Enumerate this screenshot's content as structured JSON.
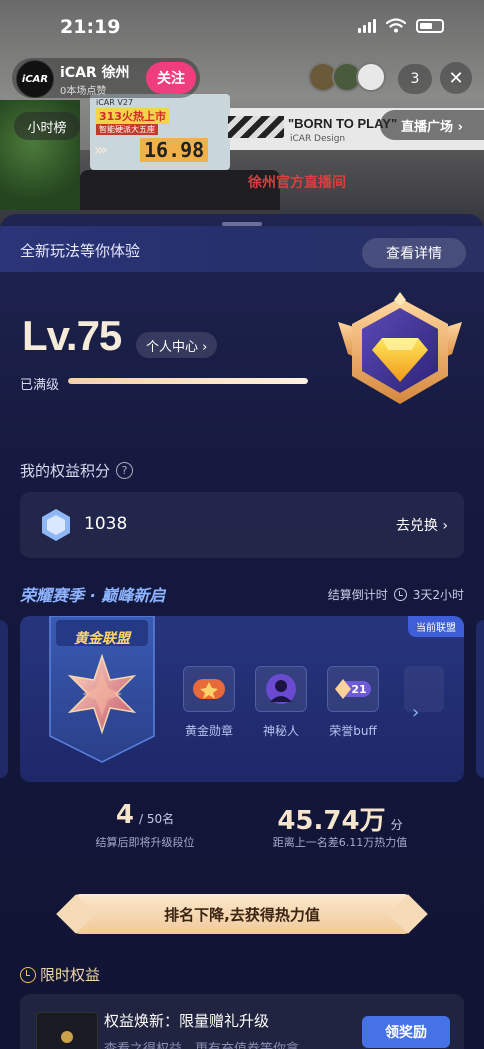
{
  "status_bar": {
    "time": "21:19"
  },
  "stream": {
    "host_avatar_text": "iCAR",
    "host_name": "iCAR 徐州",
    "host_likes": "0本场点赞",
    "follow_label": "关注",
    "viewer_count": "3",
    "hourly_rank_label": "小时榜",
    "live_square_label": "直播广场 ›",
    "scene": {
      "promo_brand": "iCAR V27",
      "promo_headline": "313火热上市",
      "promo_sub": "智能硬派大五座",
      "promo_price": "16.98",
      "banner_text": "\"BORN TO PLAY\"",
      "banner_sub": "iCAR Design",
      "sign_text": "徐州官方直播间"
    }
  },
  "panel": {
    "banner_text": "全新玩法等你体验",
    "details_label": "查看详情",
    "level": "Lv.75",
    "personal_center_label": "个人中心 ›",
    "maxed_label": "已满级",
    "level_progress": 1.0,
    "points_title": "我的权益积分",
    "points_value": "1038",
    "redeem_label": "去兑换 ›",
    "season_title": "荣耀赛季 · 巅峰新启",
    "countdown_label": "结算倒计时",
    "countdown_value": "3天2小时",
    "league": {
      "current_tag": "当前联盟",
      "name": "黄金联盟",
      "rewards": [
        {
          "icon": "gold-medal-icon",
          "label": "黄金勋章"
        },
        {
          "icon": "mystery-person-icon",
          "label": "神秘人"
        },
        {
          "icon": "honor-buff-icon",
          "label": "荣誉buff",
          "badge": "21"
        }
      ]
    },
    "rank": {
      "value": "4",
      "total": "/ 50名",
      "caption": "结算后即将升级段位"
    },
    "heat": {
      "value": "45.74万",
      "unit": "分",
      "caption": "距离上一名差6.11万热力值"
    },
    "cta_label": "排名下降,去获得热力值",
    "limited_title": "限时权益",
    "benefit": {
      "name": "权益焕新：限量赠礼升级",
      "desc": "查看之得权益，更有充值券等你拿",
      "claim_label": "领奖励"
    }
  },
  "colors": {
    "panel_bg": "#161a40",
    "accent_blue": "#4672e8",
    "follow_pink": "#f03d7e",
    "gold_text": "#f5e5cc"
  }
}
